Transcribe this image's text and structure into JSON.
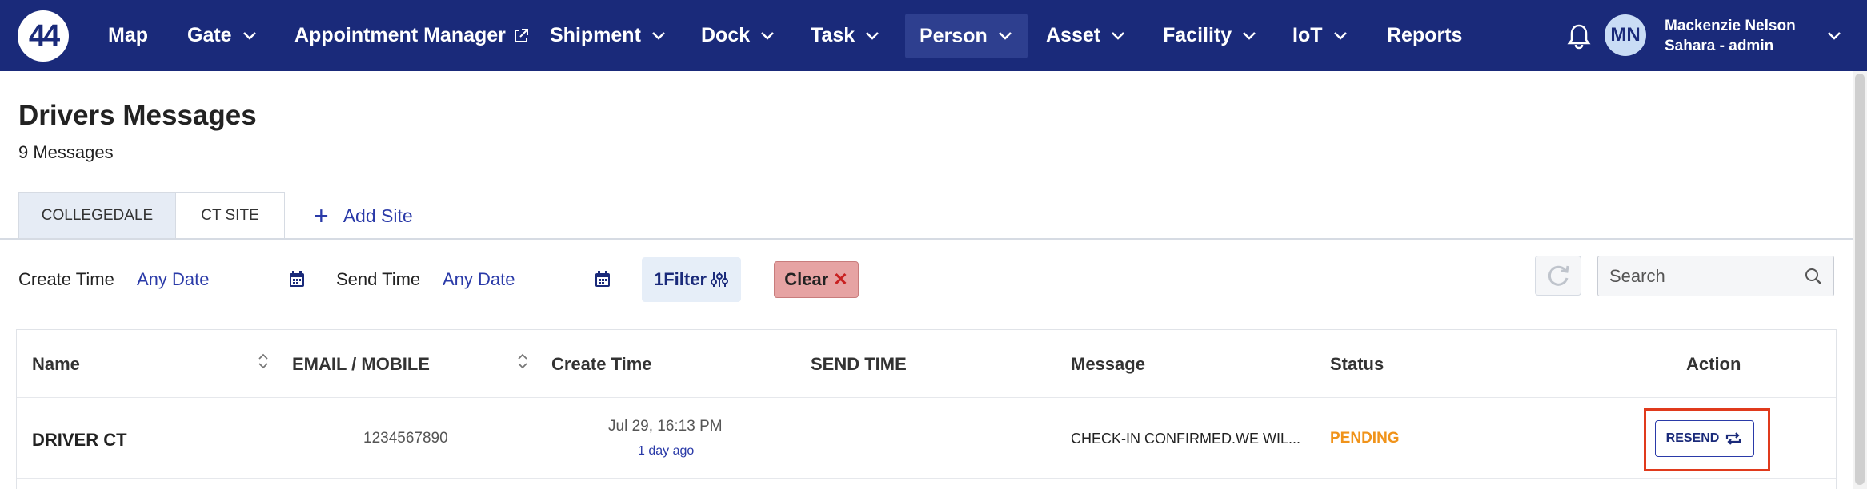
{
  "nav": {
    "logo": "44",
    "items": [
      {
        "label": "Map"
      },
      {
        "label": "Gate"
      },
      {
        "label": "Appointment Manager"
      },
      {
        "label": "Shipment"
      },
      {
        "label": "Dock"
      },
      {
        "label": "Task"
      },
      {
        "label": "Person"
      },
      {
        "label": "Asset"
      },
      {
        "label": "Facility"
      },
      {
        "label": "IoT"
      },
      {
        "label": "Reports"
      }
    ],
    "active": "Person",
    "user": {
      "initials": "MN",
      "name": "Mackenzie Nelson",
      "role": "Sahara - admin"
    }
  },
  "page": {
    "title": "Drivers Messages",
    "count": "9 Messages"
  },
  "tabs": [
    {
      "label": "COLLEGEDALE"
    },
    {
      "label": "CT SITE"
    }
  ],
  "add_site": "Add Site",
  "filters": {
    "create_label": "Create Time",
    "create_value": "Any Date",
    "send_label": "Send Time",
    "send_value": "Any Date",
    "filter_label": "1Filter",
    "clear_label": "Clear",
    "search_placeholder": "Search"
  },
  "table": {
    "columns": [
      "Name",
      "EMAIL / MOBILE",
      "Create Time",
      "SEND TIME",
      "Message",
      "Status",
      "Action"
    ],
    "rows": [
      {
        "name": "DRIVER CT",
        "mobile": "1234567890",
        "create_time": "Jul 29, 16:13 PM",
        "create_ago": "1 day ago",
        "send_time": "",
        "message": "CHECK-IN CONFIRMED.WE WIL...",
        "status": "PENDING",
        "action": "RESEND"
      }
    ]
  },
  "colors": {
    "nav": "#1a2a7a",
    "accent": "#2a3aa8",
    "pending": "#f0931a",
    "highlight": "#e03a1c"
  }
}
